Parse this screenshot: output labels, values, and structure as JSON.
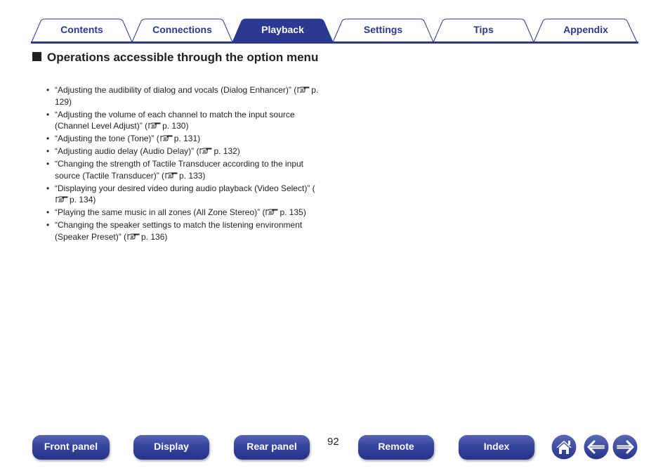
{
  "tabs": [
    {
      "label": "Contents",
      "active": false
    },
    {
      "label": "Connections",
      "active": false
    },
    {
      "label": "Playback",
      "active": true
    },
    {
      "label": "Settings",
      "active": false
    },
    {
      "label": "Tips",
      "active": false
    },
    {
      "label": "Appendix",
      "active": false
    }
  ],
  "colors": {
    "accent": "#2b3990",
    "text": "#231f20"
  },
  "heading": {
    "title": "Operations accessible through the option menu",
    "icon": "black-square"
  },
  "items": [
    {
      "text": "“Adjusting the audibility of dialog and vocals (Dialog Enhancer)” (",
      "page": "p. 129)"
    },
    {
      "text": "“Adjusting the volume of each channel to match the input source (Channel Level Adjust)” (",
      "page": "p. 130)"
    },
    {
      "text": "“Adjusting the tone (Tone)” (",
      "page": "p. 131)"
    },
    {
      "text": "“Adjusting audio delay (Audio Delay)” (",
      "page": "p. 132)"
    },
    {
      "text": "“Changing the strength of Tactile Transducer according to the input source (Tactile Transducer)” (",
      "page": "p. 133)"
    },
    {
      "text": "“Displaying your desired video during audio playback (Video Select)” (",
      "page": "p. 134)"
    },
    {
      "text": "“Playing the same music in all zones (All Zone Stereo)” (",
      "page": "p. 135)"
    },
    {
      "text": "“Changing the speaker settings to match the listening environment (Speaker Preset)” (",
      "page": "p. 136)"
    }
  ],
  "bullet": "•",
  "ref_icon": "pointing-hand-icon",
  "footer": {
    "buttons": [
      "Front panel",
      "Display",
      "Rear panel",
      "Remote",
      "Index"
    ],
    "page_number": "92",
    "icons": [
      "home-icon",
      "back-arrow-icon",
      "forward-arrow-icon"
    ]
  }
}
